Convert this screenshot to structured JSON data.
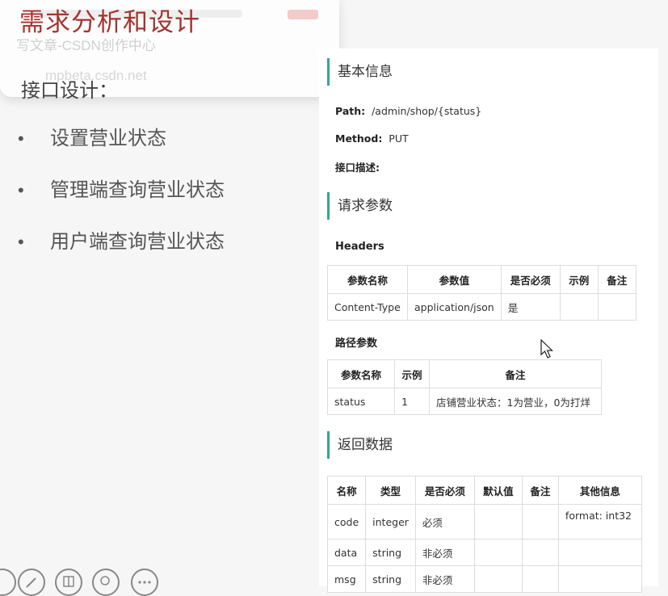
{
  "slide": {
    "title": "需求分析和设计",
    "subtitle": "接口设计：",
    "bullets": [
      "设置营业状态",
      "管理端查询营业状态",
      "用户端查询营业状态"
    ],
    "bullet_glyph": "•",
    "ghost_popup": {
      "line1": "写文章-CSDN创作中心",
      "line2": "mpbeta.csdn.net"
    }
  },
  "doc": {
    "basic_info": {
      "heading": "基本信息",
      "path_label": "Path:",
      "path_value": "/admin/shop/{status}",
      "method_label": "Method:",
      "method_value": "PUT",
      "desc_label": "接口描述:"
    },
    "request": {
      "heading": "请求参数",
      "headers_label": "Headers",
      "headers_table": {
        "columns": [
          "参数名称",
          "参数值",
          "是否必须",
          "示例",
          "备注"
        ],
        "rows": [
          [
            "Content-Type",
            "application/json",
            "是",
            "",
            ""
          ]
        ]
      },
      "path_params_label": "路径参数",
      "path_table": {
        "columns": [
          "参数名称",
          "示例",
          "备注"
        ],
        "rows": [
          [
            "status",
            "1",
            "店铺营业状态：1为营业，0为打烊"
          ]
        ]
      }
    },
    "response": {
      "heading": "返回数据",
      "table": {
        "columns": [
          "名称",
          "类型",
          "是否必须",
          "默认值",
          "备注",
          "其他信息"
        ],
        "rows": [
          [
            "code",
            "integer",
            "必须",
            "",
            "",
            "format: int32"
          ],
          [
            "data",
            "string",
            "非必须",
            "",
            "",
            ""
          ],
          [
            "msg",
            "string",
            "非必须",
            "",
            "",
            ""
          ]
        ]
      }
    }
  },
  "colors": {
    "accent_green": "#3aa58a",
    "title_red": "#a4332f"
  },
  "toolbar": {
    "icons": [
      "back-icon",
      "pen-icon",
      "grid-icon",
      "zoom-icon",
      "more-icon"
    ]
  }
}
